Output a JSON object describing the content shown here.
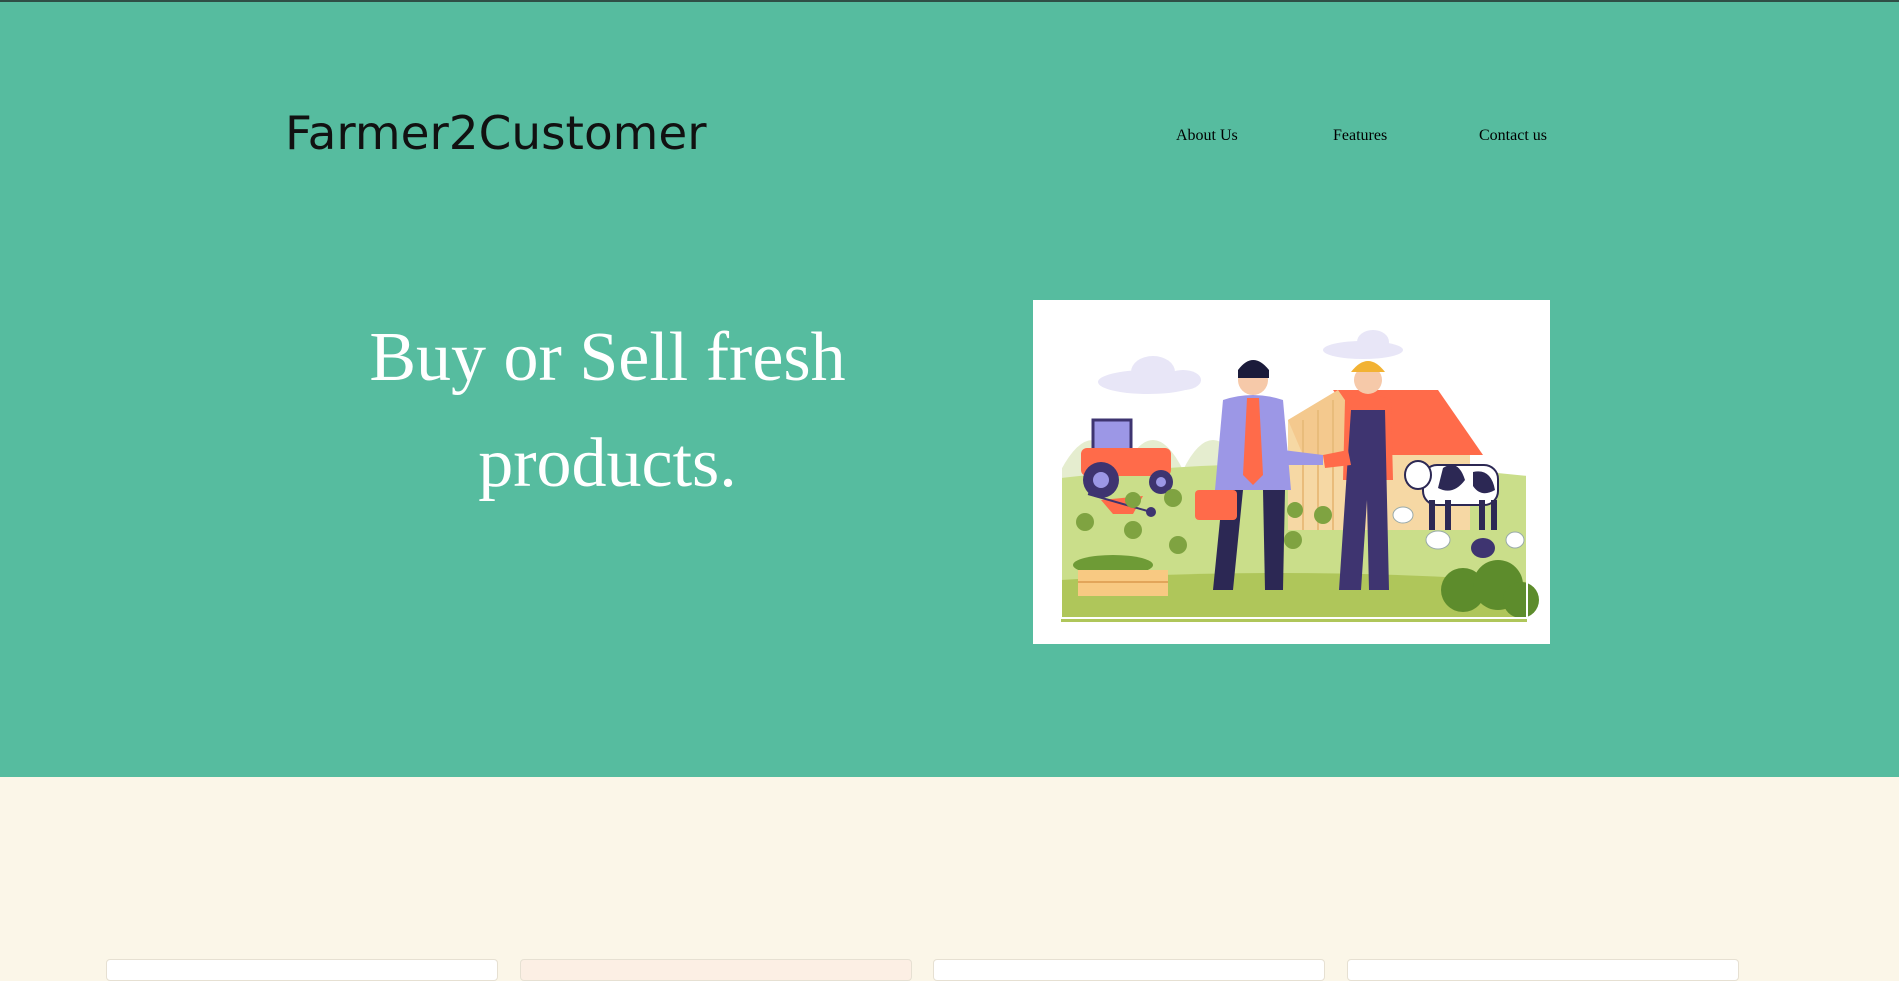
{
  "brand": {
    "name": "Farmer2Customer"
  },
  "nav": {
    "items": [
      {
        "label": "About Us"
      },
      {
        "label": "Features"
      },
      {
        "label": "Contact us"
      }
    ]
  },
  "hero": {
    "headline": "Buy or Sell fresh products.",
    "illustration_icon": "farmer-customer-handshake-illustration"
  },
  "colors": {
    "hero_bg": "#56BC9F",
    "page_bg": "#FBF6E8",
    "brand_text": "#111111",
    "nav_text": "#2f5446",
    "headline_text": "#ffffff"
  },
  "cards": {
    "count_visible": 4
  }
}
